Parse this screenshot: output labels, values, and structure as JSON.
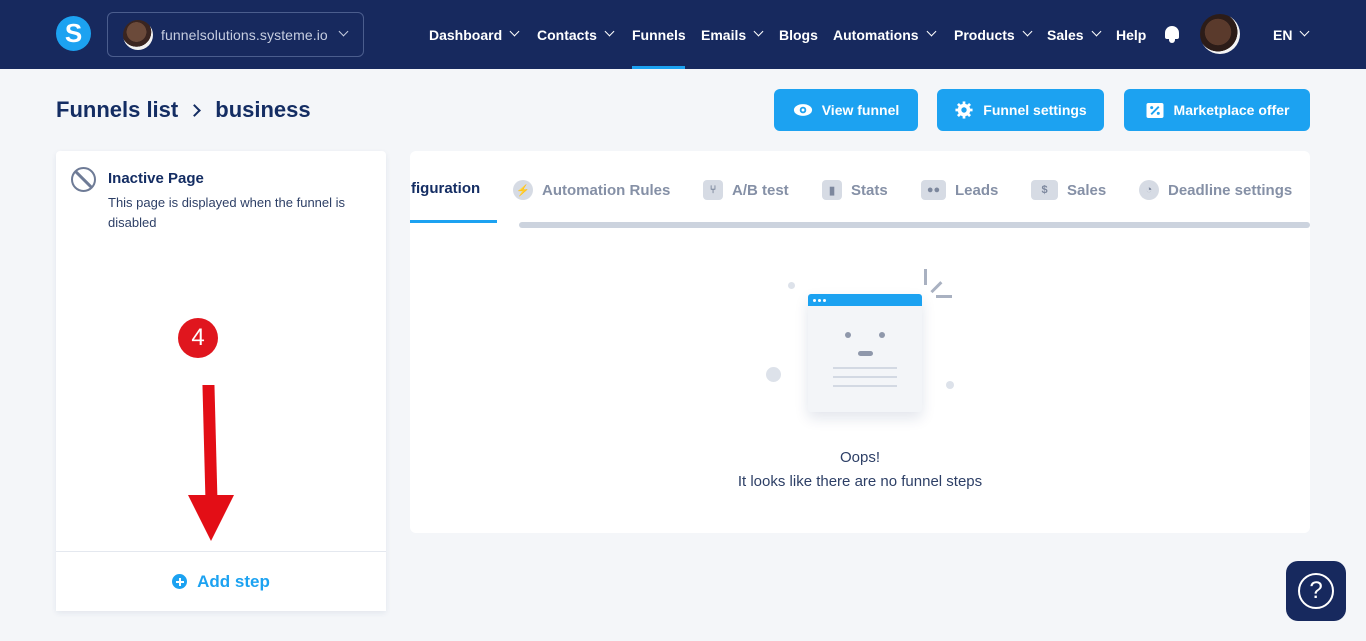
{
  "nav": {
    "logo": "S",
    "workspace": "funnelsolutions.systeme.io",
    "items": [
      {
        "label": "Dashboard"
      },
      {
        "label": "Contacts"
      },
      {
        "label": "Funnels"
      },
      {
        "label": "Emails"
      },
      {
        "label": "Blogs"
      },
      {
        "label": "Automations"
      },
      {
        "label": "Products"
      },
      {
        "label": "Sales"
      },
      {
        "label": "Help"
      }
    ],
    "language": "EN"
  },
  "breadcrumb": {
    "root": "Funnels list",
    "current": "business"
  },
  "actions": {
    "view_funnel": "View funnel",
    "funnel_settings": "Funnel settings",
    "marketplace_offer": "Marketplace offer"
  },
  "left_panel": {
    "inactive_title": "Inactive Page",
    "inactive_desc": "This page is displayed when the funnel is disabled",
    "add_step": "Add step",
    "annotation_number": "4"
  },
  "tabs": [
    {
      "label": "figuration",
      "icon": "settings-icon",
      "active": true
    },
    {
      "label": "Automation Rules",
      "icon": "bolt-icon"
    },
    {
      "label": "A/B test",
      "icon": "split-icon"
    },
    {
      "label": "Stats",
      "icon": "bar-chart-icon"
    },
    {
      "label": "Leads",
      "icon": "people-icon"
    },
    {
      "label": "Sales",
      "icon": "dollar-icon"
    },
    {
      "label": "Deadline settings",
      "icon": "clock-icon"
    }
  ],
  "empty_state": {
    "title": "Oops!",
    "message": "It looks like there are no funnel steps"
  },
  "help_button": "?",
  "colors": {
    "navbar": "#17295e",
    "accent": "#1ca2f1",
    "annotation": "#e30e16"
  }
}
